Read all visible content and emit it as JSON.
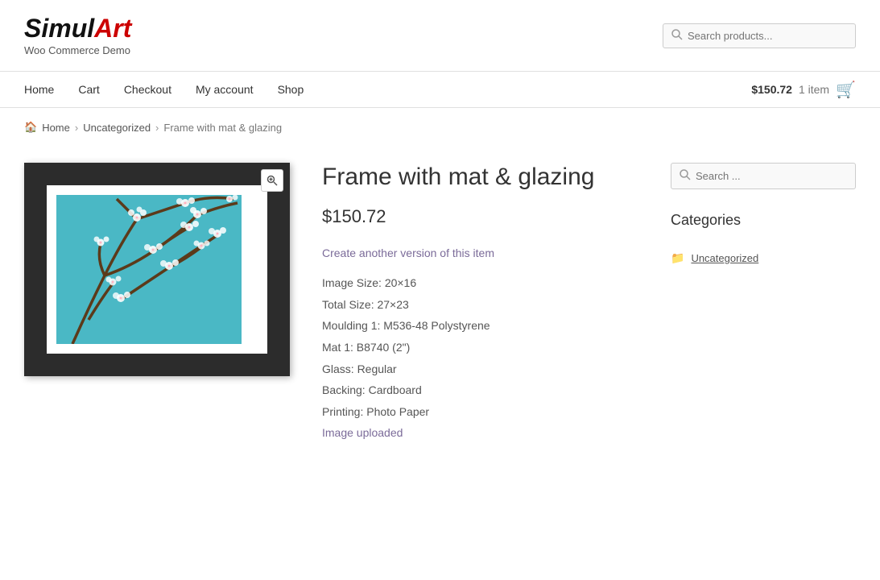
{
  "site": {
    "name_simul": "Simul",
    "name_art": "Art",
    "tagline": "Woo Commerce Demo"
  },
  "header": {
    "search_placeholder": "Search products..."
  },
  "nav": {
    "links": [
      {
        "label": "Home",
        "href": "#"
      },
      {
        "label": "Cart",
        "href": "#"
      },
      {
        "label": "Checkout",
        "href": "#"
      },
      {
        "label": "My account",
        "href": "#"
      },
      {
        "label": "Shop",
        "href": "#"
      }
    ],
    "cart_amount": "$150.72",
    "cart_items": "1 item"
  },
  "breadcrumb": {
    "home": "Home",
    "category": "Uncategorized",
    "current": "Frame with mat & glazing"
  },
  "product": {
    "title": "Frame with mat & glazing",
    "price": "$150.72",
    "create_link": "Create another version of this item",
    "meta": [
      {
        "label": "Image Size: 20×16"
      },
      {
        "label": "Total Size: 27×23"
      },
      {
        "label": "Moulding 1: M536-48 Polystyrene"
      },
      {
        "label": "Mat 1: B8740 (2\")"
      },
      {
        "label": "Glass: Regular"
      },
      {
        "label": "Backing: Cardboard"
      },
      {
        "label": "Printing: Photo Paper"
      },
      {
        "label": "Image uploaded"
      }
    ]
  },
  "sidebar": {
    "search_placeholder": "Search ...",
    "categories_title": "Categories",
    "categories": [
      {
        "label": "Uncategorized",
        "href": "#"
      }
    ]
  }
}
